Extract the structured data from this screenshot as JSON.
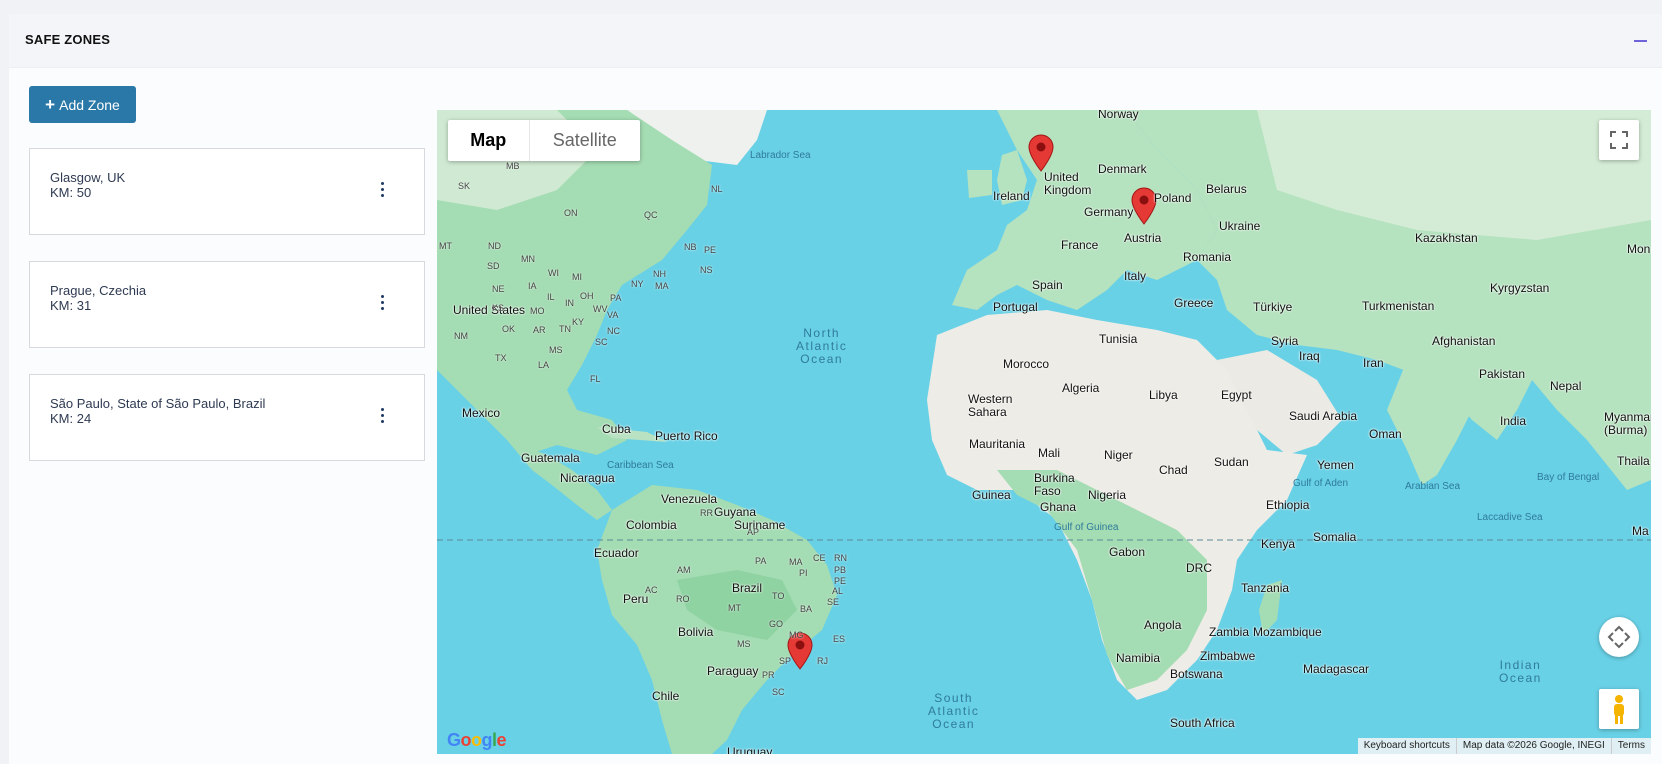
{
  "section": {
    "title": "SAFE ZONES",
    "add_button_label": "Add Zone"
  },
  "zones": [
    {
      "name": "Glasgow, UK",
      "km": "KM: 50"
    },
    {
      "name": "Prague, Czechia",
      "km": "KM: 31"
    },
    {
      "name": "São Paulo, State of São Paulo, Brazil",
      "km": "KM: 24"
    }
  ],
  "map": {
    "type_buttons": {
      "map": "Map",
      "satellite": "Satellite"
    },
    "logo": "Google",
    "attribution": {
      "shortcuts": "Keyboard shortcuts",
      "data": "Map data ©2026 Google, INEGI",
      "terms": "Terms"
    },
    "labels": {
      "norway": "Norway",
      "labrador_sea": "Labrador Sea",
      "united_kingdom": "United\nKingdom",
      "denmark": "Denmark",
      "ireland": "Ireland",
      "belarus": "Belarus",
      "germany": "Germany",
      "poland": "Poland",
      "ukraine": "Ukraine",
      "france": "France",
      "austria": "Austria",
      "romania": "Romania",
      "kazakhstan": "Kazakhstan",
      "mon": "Mon",
      "italy": "Italy",
      "spain": "Spain",
      "portugal": "Portugal",
      "greece": "Greece",
      "turkiye": "Türkiye",
      "kyrgyzstan": "Kyrgyzstan",
      "turkmenistan": "Turkmenistan",
      "tunisia": "Tunisia",
      "syria": "Syria",
      "iraq": "Iraq",
      "afghanistan": "Afghanistan",
      "iran": "Iran",
      "morocco": "Morocco",
      "pakistan": "Pakistan",
      "nepal": "Nepal",
      "algeria": "Algeria",
      "libya": "Libya",
      "egypt": "Egypt",
      "western_sahara": "Western\nSahara",
      "saudi_arabia": "Saudi Arabia",
      "oman": "Oman",
      "india": "India",
      "myanmar": "Myanmar\n(Burma)",
      "mauritania": "Mauritania",
      "mali": "Mali",
      "niger": "Niger",
      "chad": "Chad",
      "sudan": "Sudan",
      "yemen": "Yemen",
      "thaila": "Thaila",
      "bay_of_bengal": "Bay of Bengal",
      "burkina_faso": "Burkina\nFaso",
      "guinea": "Guinea",
      "nigeria": "Nigeria",
      "ghana": "Ghana",
      "gulf_of_aden": "Gulf of Aden",
      "arabian_sea": "Arabian Sea",
      "ethiopia": "Ethiopia",
      "laccadive_sea": "Laccadive Sea",
      "gulf_of_guinea": "Gulf of Guinea",
      "somalia": "Somalia",
      "kenya": "Kenya",
      "ma": "Ma",
      "gabon": "Gabon",
      "drc": "DRC",
      "tanzania": "Tanzania",
      "angola": "Angola",
      "zambia": "Zambia",
      "mozambique": "Mozambique",
      "namibia": "Namibia",
      "zimbabwe": "Zimbabwe",
      "madagascar": "Madagascar",
      "botswana": "Botswana",
      "south_africa": "South Africa",
      "indian_ocean": "Indian\nOcean",
      "south_atlantic": "South\nAtlantic\nOcean",
      "north_atlantic": "North\nAtlantic\nOcean",
      "united_states": "United States",
      "mexico": "Mexico",
      "cuba": "Cuba",
      "puerto_rico": "Puerto Rico",
      "guatemala": "Guatemala",
      "caribbean_sea": "Caribbean Sea",
      "nicaragua": "Nicaragua",
      "venezuela": "Venezuela",
      "guyana": "Guyana",
      "suriname": "Suriname",
      "colombia": "Colombia",
      "ecuador": "Ecuador",
      "brazil": "Brazil",
      "peru": "Peru",
      "bolivia": "Bolivia",
      "paraguay": "Paraguay",
      "chile": "Chile",
      "uruguay": "Uruguay",
      "st_mb": "MB",
      "st_sk": "SK",
      "st_on": "ON",
      "st_qc": "QC",
      "st_nl": "NL",
      "st_nb": "NB",
      "st_pe": "PE",
      "st_ns": "NS",
      "st_mt": "MT",
      "st_nd": "ND",
      "st_mn": "MN",
      "st_sd": "SD",
      "st_wi": "WI",
      "st_mi": "MI",
      "st_ny": "NY",
      "st_nh": "NH",
      "st_ma": "MA",
      "st_ne": "NE",
      "st_ia": "IA",
      "st_il": "IL",
      "st_in": "IN",
      "st_oh": "OH",
      "st_pa": "PA",
      "st_ks": "KS",
      "st_mo": "MO",
      "st_ky": "KY",
      "st_wv": "WV",
      "st_va": "VA",
      "st_nm": "NM",
      "st_ok": "OK",
      "st_ar": "AR",
      "st_tn": "TN",
      "st_nc": "NC",
      "st_sc": "SC",
      "st_ms": "MS",
      "st_tx": "TX",
      "st_la": "LA",
      "st_fl": "FL",
      "st_rr": "RR",
      "st_ap": "AP",
      "st_am": "AM",
      "st_pa2": "PA",
      "st_ma2": "MA",
      "st_ce": "CE",
      "st_rn": "RN",
      "st_pb": "PB",
      "st_pi": "PI",
      "st_pe2": "PE",
      "st_ac": "AC",
      "st_ro": "RO",
      "st_to": "TO",
      "st_al": "AL",
      "st_se": "SE",
      "st_mt2": "MT",
      "st_ba": "BA",
      "st_go": "GO",
      "st_mg": "MG",
      "st_ms2": "MS",
      "st_es": "ES",
      "st_sp": "SP",
      "st_rj": "RJ",
      "st_pr": "PR",
      "st_sc2": "SC"
    }
  }
}
